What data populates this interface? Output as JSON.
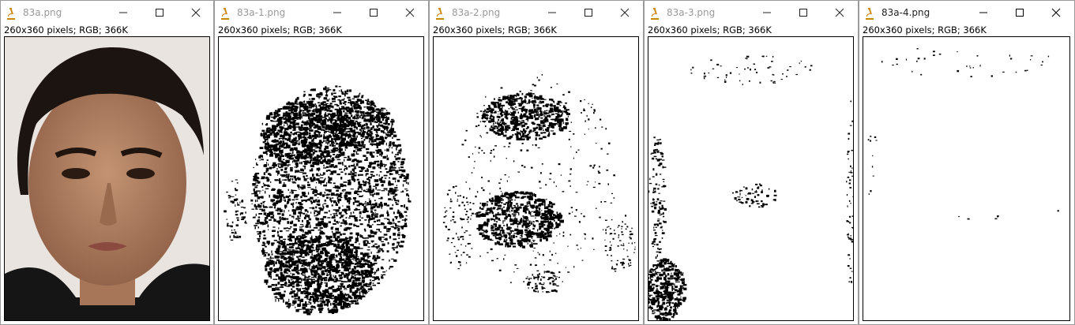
{
  "windows": [
    {
      "title": "83a.png",
      "info": "260x360 pixels; RGB; 366K",
      "image": "face-photo-icon"
    },
    {
      "title": "83a-1.png",
      "info": "260x360 pixels; RGB; 366K",
      "image": "threshold-mask-1"
    },
    {
      "title": "83a-2.png",
      "info": "260x360 pixels; RGB; 366K",
      "image": "threshold-mask-2"
    },
    {
      "title": "83a-3.png",
      "info": "260x360 pixels; RGB; 366K",
      "image": "threshold-mask-3"
    },
    {
      "title": "83a-4.png",
      "info": "260x360 pixels; RGB; 366K",
      "image": "threshold-mask-4"
    }
  ],
  "active_window_index": 4,
  "colors": {
    "titlebar": "#ffffff",
    "inactive_title": "#999999",
    "active_title": "#222222",
    "desktop": "#6f6f6f"
  }
}
